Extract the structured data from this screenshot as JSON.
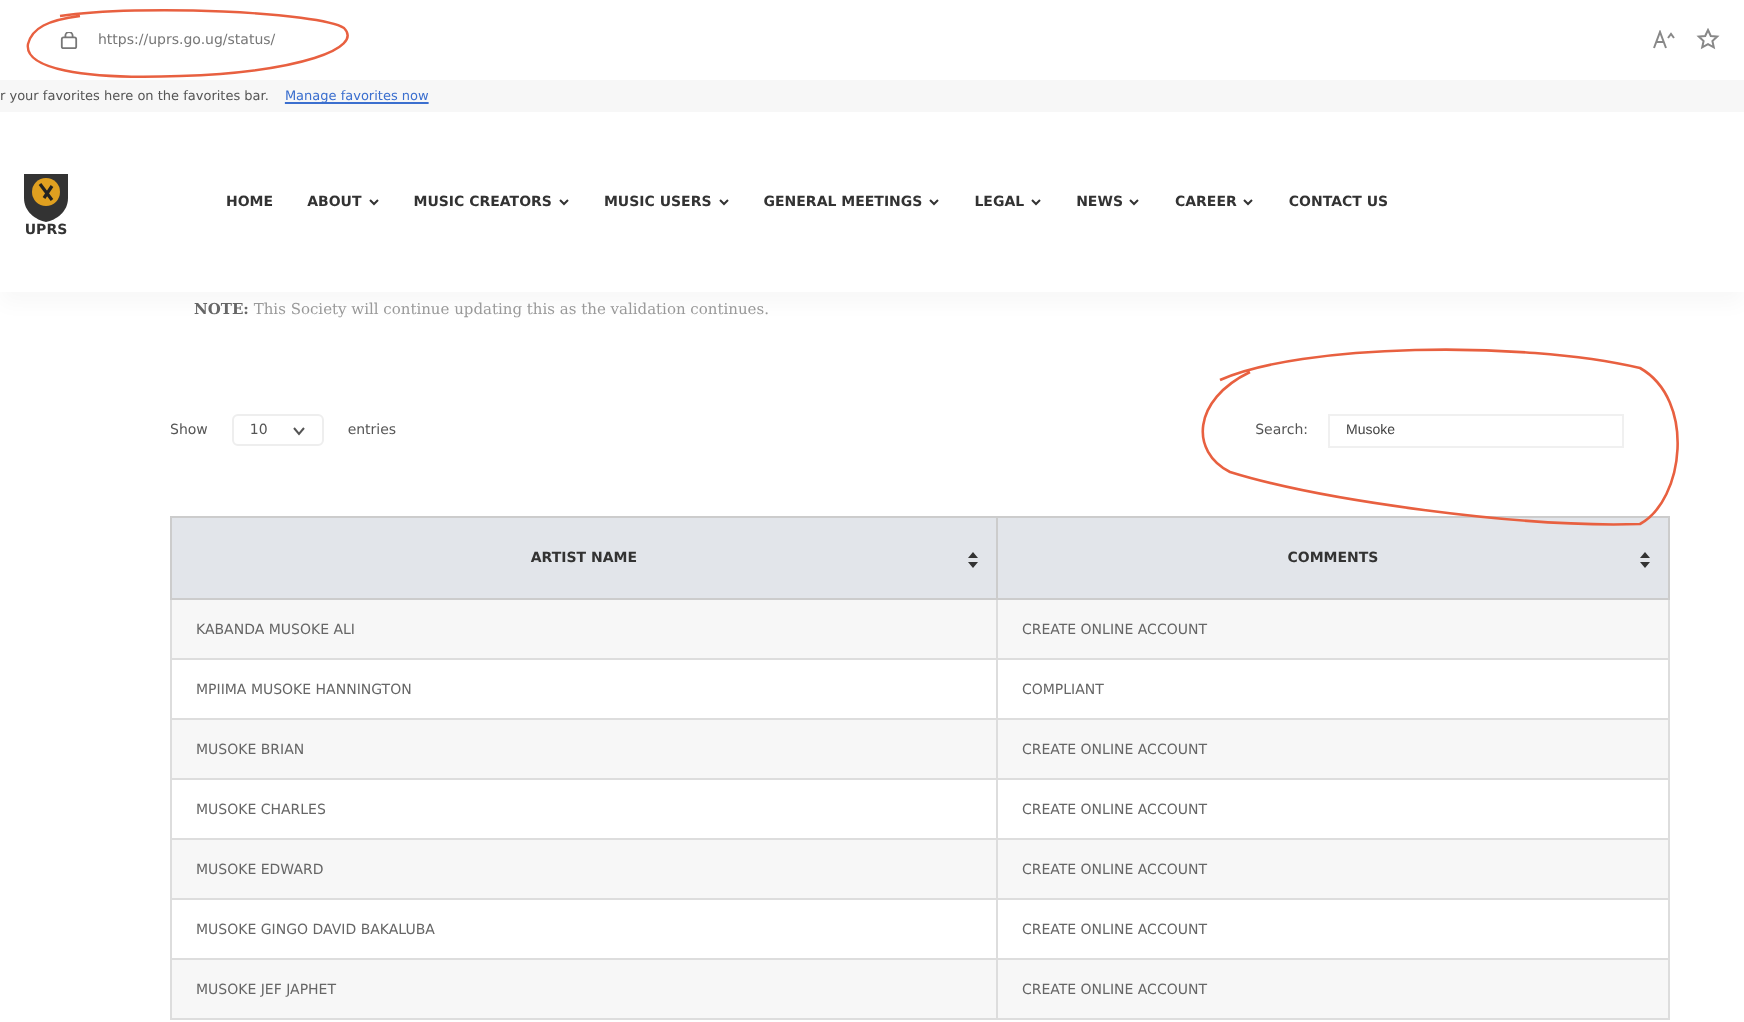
{
  "browser": {
    "url": "https://uprs.go.ug/status/",
    "favorites_bar": {
      "message": "r your favorites here on the favorites bar.",
      "link": "Manage favorites now"
    }
  },
  "site": {
    "logo_text": "UPRS",
    "nav": [
      {
        "label": "HOME",
        "dropdown": false
      },
      {
        "label": "ABOUT",
        "dropdown": true
      },
      {
        "label": "MUSIC CREATORS",
        "dropdown": true
      },
      {
        "label": "MUSIC USERS",
        "dropdown": true
      },
      {
        "label": "GENERAL MEETINGS",
        "dropdown": true
      },
      {
        "label": "LEGAL",
        "dropdown": true
      },
      {
        "label": "NEWS",
        "dropdown": true
      },
      {
        "label": "CAREER",
        "dropdown": true
      },
      {
        "label": "CONTACT US",
        "dropdown": false
      }
    ]
  },
  "note": "**NOTE:** This Society will continue updating this as the validation continues.",
  "table_controls": {
    "show_label": "Show",
    "page_size": "10",
    "entries_label": "entries",
    "search_label": "Search:",
    "search_value": "Musoke"
  },
  "table": {
    "columns": [
      "ARTIST NAME",
      "COMMENTS"
    ],
    "rows": [
      [
        "KABANDA MUSOKE ALI",
        "CREATE ONLINE ACCOUNT"
      ],
      [
        "MPIIMA MUSOKE HANNINGTON",
        "COMPLIANT"
      ],
      [
        "MUSOKE BRIAN",
        "CREATE ONLINE ACCOUNT"
      ],
      [
        "MUSOKE CHARLES",
        "CREATE ONLINE ACCOUNT"
      ],
      [
        "MUSOKE EDWARD",
        "CREATE ONLINE ACCOUNT"
      ],
      [
        "MUSOKE GINGO DAVID BAKALUBA",
        "CREATE ONLINE ACCOUNT"
      ],
      [
        "MUSOKE JEF JAPHET",
        "CREATE ONLINE ACCOUNT"
      ]
    ]
  }
}
